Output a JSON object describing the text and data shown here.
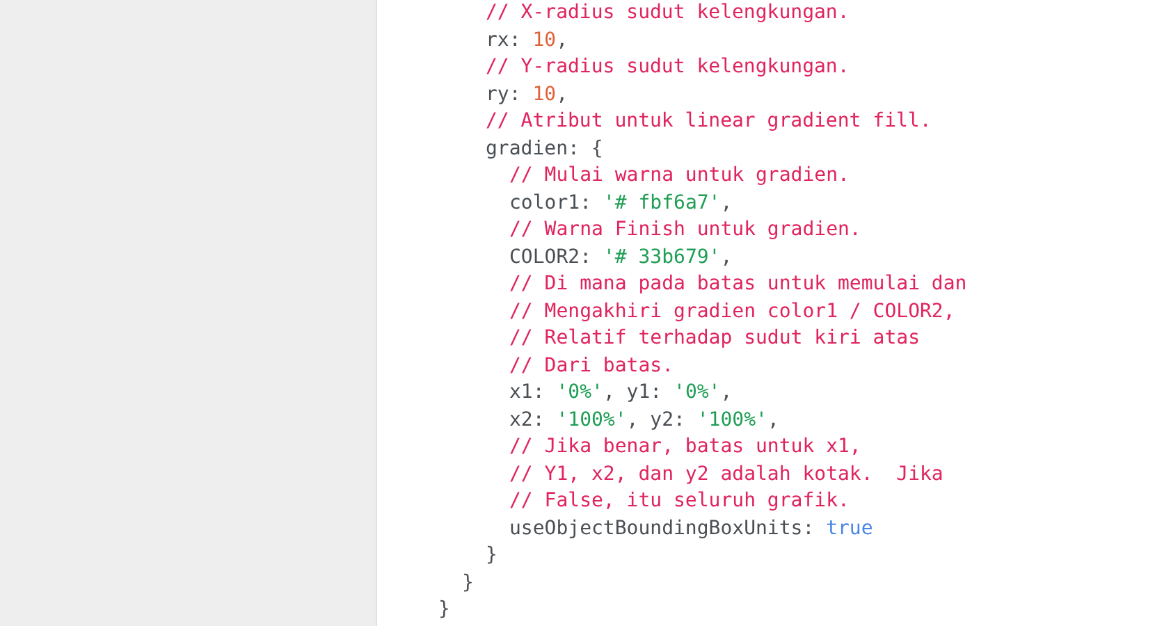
{
  "code": {
    "lines": [
      {
        "children": [
          {
            "children": [
              {
                "segments": [
                  {
                    "kind": "comment",
                    "text": "// X-radius sudut kelengkungan."
                  }
                ]
              },
              {
                "segments": [
                  {
                    "kind": "plain",
                    "text": "rx: "
                  },
                  {
                    "kind": "number",
                    "text": "10"
                  },
                  {
                    "kind": "plain",
                    "text": ","
                  }
                ]
              },
              {
                "segments": [
                  {
                    "kind": "comment",
                    "text": "// Y-radius sudut kelengkungan."
                  }
                ]
              },
              {
                "segments": [
                  {
                    "kind": "plain",
                    "text": "ry: "
                  },
                  {
                    "kind": "number",
                    "text": "10"
                  },
                  {
                    "kind": "plain",
                    "text": ","
                  }
                ]
              },
              {
                "segments": [
                  {
                    "kind": "comment",
                    "text": "// Atribut untuk linear gradient fill."
                  }
                ]
              },
              {
                "segments": [
                  {
                    "kind": "plain",
                    "text": "gradien: {"
                  }
                ],
                "children": [
                  {
                    "segments": [
                      {
                        "kind": "comment",
                        "text": "// Mulai warna untuk gradien."
                      }
                    ]
                  },
                  {
                    "segments": [
                      {
                        "kind": "plain",
                        "text": "color1: "
                      },
                      {
                        "kind": "string",
                        "text": "'# fbf6a7'"
                      },
                      {
                        "kind": "plain",
                        "text": ","
                      }
                    ]
                  },
                  {
                    "segments": [
                      {
                        "kind": "comment",
                        "text": "// Warna Finish untuk gradien."
                      }
                    ]
                  },
                  {
                    "segments": [
                      {
                        "kind": "plain",
                        "text": "COLOR2: "
                      },
                      {
                        "kind": "string",
                        "text": "'# 33b679'"
                      },
                      {
                        "kind": "plain",
                        "text": ","
                      }
                    ]
                  },
                  {
                    "segments": [
                      {
                        "kind": "comment",
                        "text": "// Di mana pada batas untuk memulai dan"
                      }
                    ]
                  },
                  {
                    "segments": [
                      {
                        "kind": "comment",
                        "text": "// Mengakhiri gradien color1 / COLOR2,"
                      }
                    ]
                  },
                  {
                    "segments": [
                      {
                        "kind": "comment",
                        "text": "// Relatif terhadap sudut kiri atas"
                      }
                    ]
                  },
                  {
                    "segments": [
                      {
                        "kind": "comment",
                        "text": "// Dari batas."
                      }
                    ]
                  },
                  {
                    "segments": [
                      {
                        "kind": "plain",
                        "text": "x1: "
                      },
                      {
                        "kind": "string",
                        "text": "'0%'"
                      },
                      {
                        "kind": "plain",
                        "text": ", y1: "
                      },
                      {
                        "kind": "string",
                        "text": "'0%'"
                      },
                      {
                        "kind": "plain",
                        "text": ","
                      }
                    ]
                  },
                  {
                    "segments": [
                      {
                        "kind": "plain",
                        "text": "x2: "
                      },
                      {
                        "kind": "string",
                        "text": "'100%'"
                      },
                      {
                        "kind": "plain",
                        "text": ", y2: "
                      },
                      {
                        "kind": "string",
                        "text": "'100%'"
                      },
                      {
                        "kind": "plain",
                        "text": ","
                      }
                    ]
                  },
                  {
                    "segments": [
                      {
                        "kind": "comment",
                        "text": "// Jika benar, batas untuk x1,"
                      }
                    ]
                  },
                  {
                    "segments": [
                      {
                        "kind": "comment",
                        "text": "// Y1, x2, dan y2 adalah kotak.  Jika"
                      }
                    ]
                  },
                  {
                    "segments": [
                      {
                        "kind": "comment",
                        "text": "// False, itu seluruh grafik."
                      }
                    ]
                  },
                  {
                    "segments": [
                      {
                        "kind": "plain",
                        "text": "useObjectBoundingBoxUnits: "
                      },
                      {
                        "kind": "keyword",
                        "text": "true"
                      }
                    ]
                  }
                ]
              },
              {
                "segments": [
                  {
                    "text": "}"
                  }
                ]
              }
            ]
          },
          {
            "segments": [
              {
                "text": "}"
              }
            ]
          }
        ]
      },
      {
        "segments": [
          {
            "text": "}"
          }
        ]
      }
    ]
  }
}
